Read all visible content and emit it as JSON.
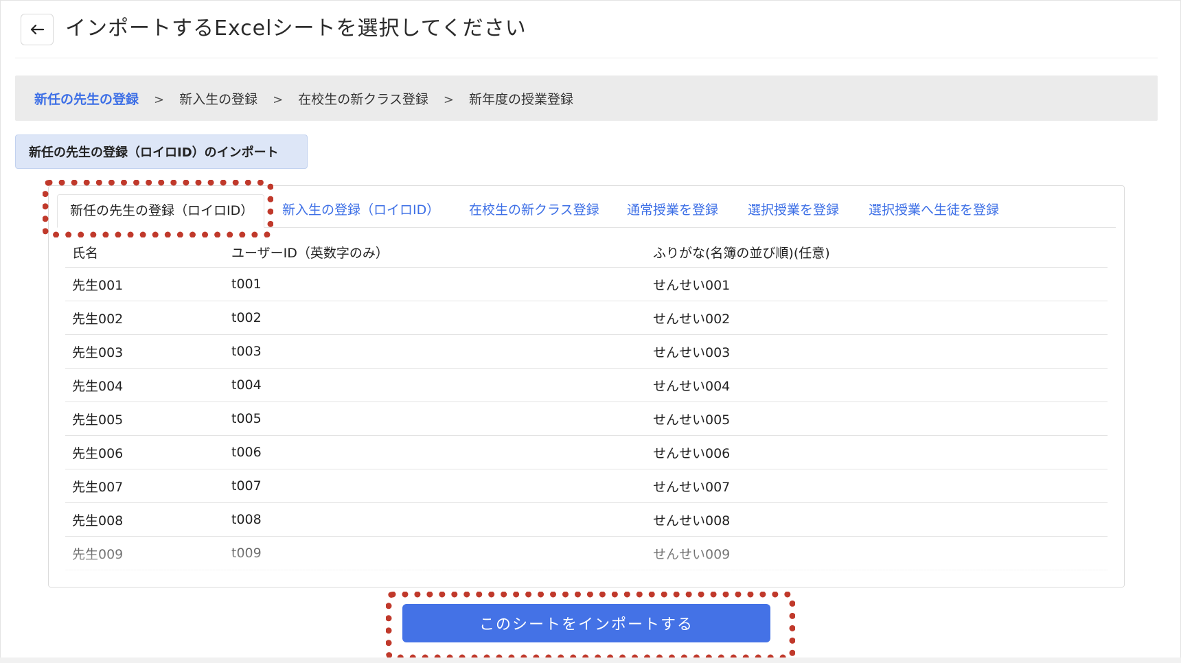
{
  "header": {
    "title": "インポートするExcelシートを選択してください"
  },
  "breadcrumb": [
    {
      "label": "新任の先生の登録",
      "active": true
    },
    {
      "label": "新入生の登録",
      "active": false
    },
    {
      "label": "在校生の新クラス登録",
      "active": false
    },
    {
      "label": "新年度の授業登録",
      "active": false
    }
  ],
  "breadcrumb_separator": ">",
  "section_label": "新任の先生の登録（ロイロID）のインポート",
  "tabs": [
    {
      "label": "新任の先生の登録（ロイロID）",
      "active": true
    },
    {
      "label": "新入生の登録（ロイロID）",
      "active": false
    },
    {
      "label": "在校生の新クラス登録",
      "active": false
    },
    {
      "label": "通常授業を登録",
      "active": false
    },
    {
      "label": "選択授業を登録",
      "active": false
    },
    {
      "label": "選択授業へ生徒を登録",
      "active": false
    }
  ],
  "table": {
    "columns": [
      "氏名",
      "ユーザーID（英数字のみ）",
      "ふりがな(名簿の並び順)(任意)"
    ],
    "rows": [
      [
        "先生001",
        "t001",
        "せんせい001"
      ],
      [
        "先生002",
        "t002",
        "せんせい002"
      ],
      [
        "先生003",
        "t003",
        "せんせい003"
      ],
      [
        "先生004",
        "t004",
        "せんせい004"
      ],
      [
        "先生005",
        "t005",
        "せんせい005"
      ],
      [
        "先生006",
        "t006",
        "せんせい006"
      ],
      [
        "先生007",
        "t007",
        "せんせい007"
      ],
      [
        "先生008",
        "t008",
        "せんせい008"
      ],
      [
        "先生009",
        "t009",
        "せんせい009"
      ]
    ]
  },
  "import_button": "このシートをインポートする",
  "colors": {
    "accent": "#3d6fe6",
    "button": "#4472e6",
    "highlight": "#c0392b",
    "breadcrumb_bg": "#ebebeb",
    "pill_bg": "#dde6f7"
  },
  "icons": {
    "back": "arrow-left-icon"
  }
}
